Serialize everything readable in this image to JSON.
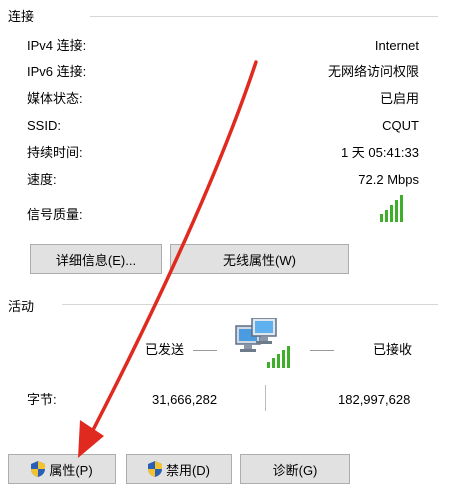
{
  "connection": {
    "title": "连接",
    "rows": [
      {
        "label": "IPv4 连接:",
        "value": "Internet"
      },
      {
        "label": "IPv6 连接:",
        "value": "无网络访问权限"
      },
      {
        "label": "媒体状态:",
        "value": "已启用"
      },
      {
        "label": "SSID:",
        "value": "CQUT"
      },
      {
        "label": "持续时间:",
        "value": "1 天 05:41:33"
      },
      {
        "label": "速度:",
        "value": "72.2 Mbps"
      },
      {
        "label": "信号质量:",
        "value": ""
      }
    ],
    "signal_bars": {
      "filled": 5,
      "total": 5
    },
    "details_button": "详细信息(E)...",
    "wireless_button": "无线属性(W)"
  },
  "activity": {
    "title": "活动",
    "sent_label": "已发送",
    "received_label": "已接收",
    "bytes_label": "字节:",
    "sent_value": "31,666,282",
    "received_value": "182,997,628"
  },
  "buttons": {
    "properties": "属性(P)",
    "disable": "禁用(D)",
    "diagnose": "诊断(G)"
  },
  "colors": {
    "signal": "#3fae2a",
    "arrow": "#e02a20",
    "shield_blue": "#2a5fb8",
    "shield_yellow": "#f2c230"
  }
}
